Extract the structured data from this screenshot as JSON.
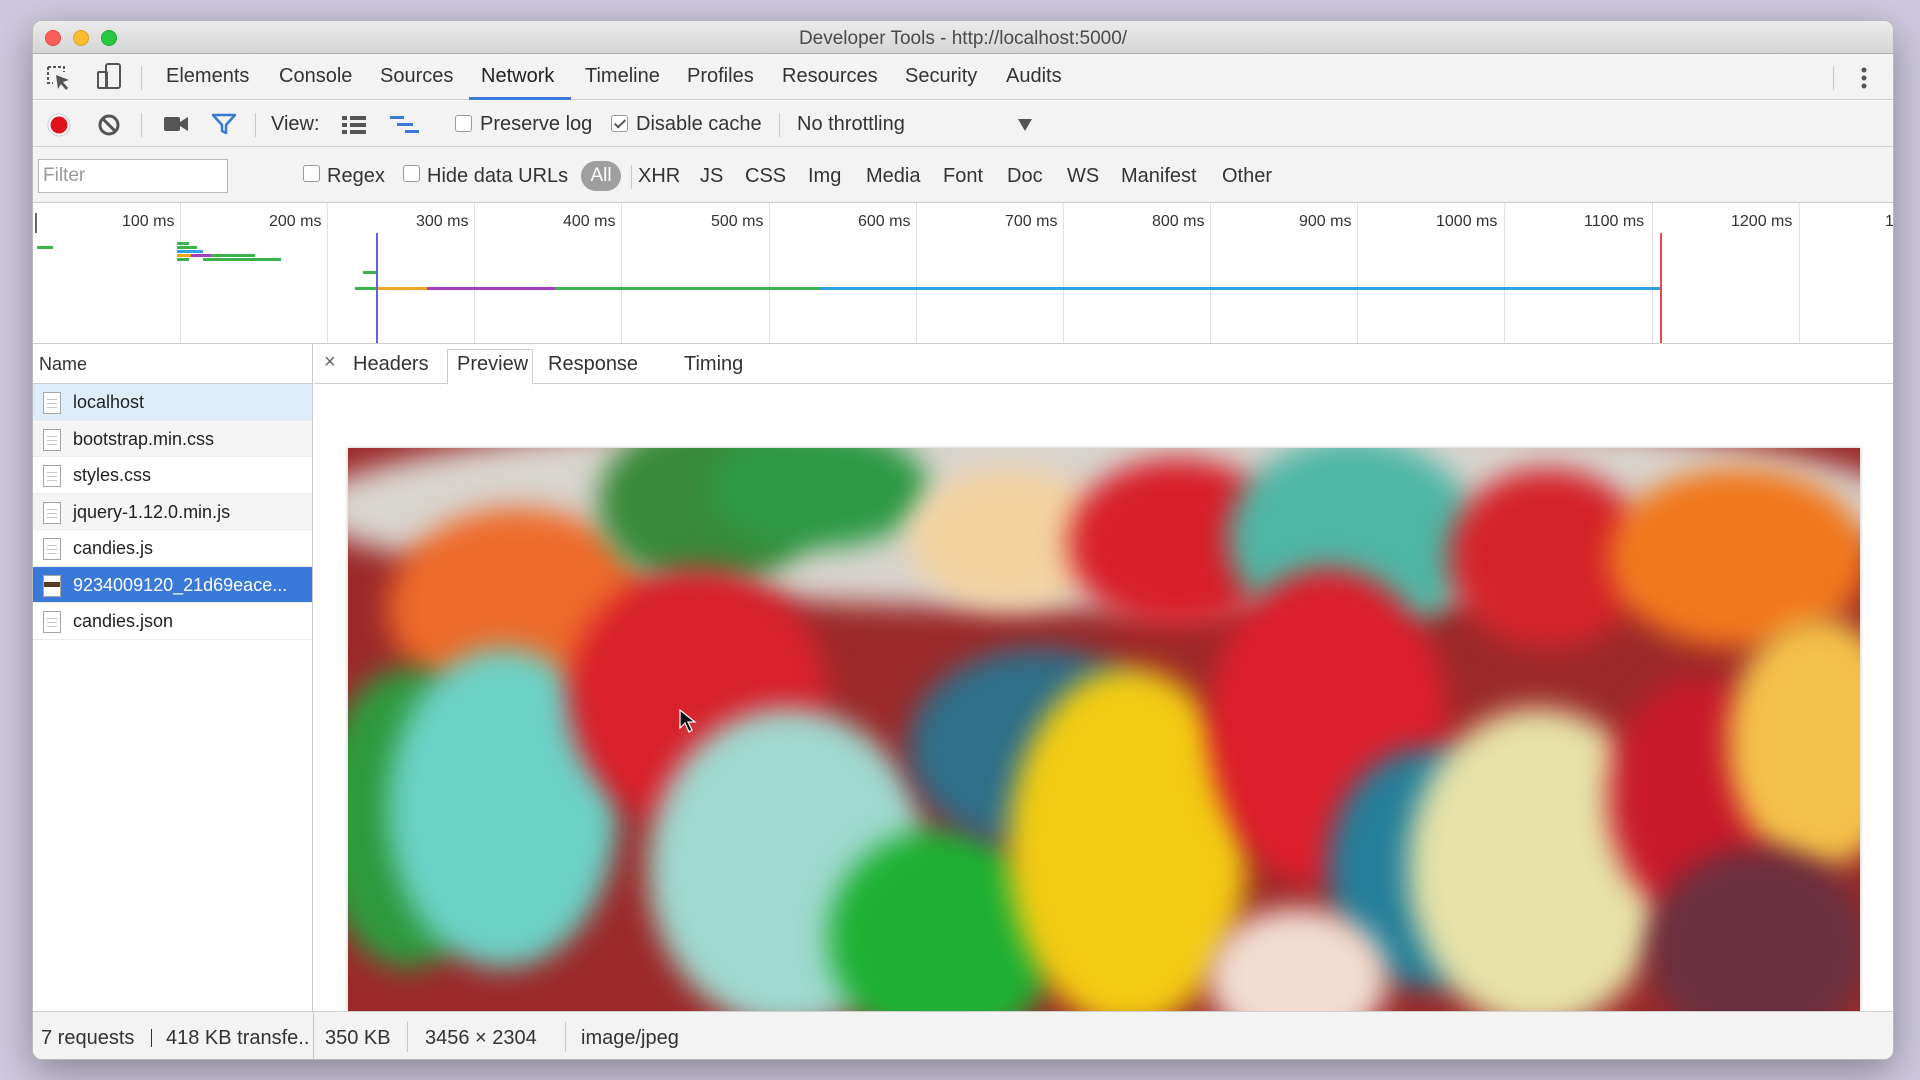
{
  "window": {
    "title": "Developer Tools - http://localhost:5000/"
  },
  "panel_tabs": [
    {
      "label": "Elements"
    },
    {
      "label": "Console"
    },
    {
      "label": "Sources"
    },
    {
      "label": "Network"
    },
    {
      "label": "Timeline"
    },
    {
      "label": "Profiles"
    },
    {
      "label": "Resources"
    },
    {
      "label": "Security"
    },
    {
      "label": "Audits"
    }
  ],
  "active_panel": "Network",
  "toolbar": {
    "view_label": "View:",
    "preserve_log": {
      "label": "Preserve log",
      "checked": false
    },
    "disable_cache": {
      "label": "Disable cache",
      "checked": true
    },
    "throttling": "No throttling",
    "record_color": "#e0121b",
    "filter_icon_color": "#3879d9"
  },
  "filter": {
    "placeholder": "Filter",
    "regex_label": "Regex",
    "hide_data_urls_label": "Hide data URLs",
    "types": [
      "All",
      "XHR",
      "JS",
      "CSS",
      "Img",
      "Media",
      "Font",
      "Doc",
      "WS",
      "Manifest",
      "Other"
    ],
    "active_type": "All"
  },
  "timeline": {
    "ticks": [
      "100 ms",
      "200 ms",
      "300 ms",
      "400 ms",
      "500 ms",
      "600 ms",
      "700 ms",
      "800 ms",
      "900 ms",
      "1000 ms",
      "1100 ms",
      "1200 ms",
      "1"
    ]
  },
  "requests": {
    "header": "Name",
    "items": [
      {
        "name": "localhost",
        "icon": "document-icon"
      },
      {
        "name": "bootstrap.min.css",
        "icon": "document-icon"
      },
      {
        "name": "styles.css",
        "icon": "document-icon"
      },
      {
        "name": "jquery-1.12.0.min.js",
        "icon": "document-icon"
      },
      {
        "name": "candies.js",
        "icon": "document-icon"
      },
      {
        "name": "9234009120_21d69eace...",
        "icon": "image-icon",
        "selected": true
      },
      {
        "name": "candies.json",
        "icon": "blank-file-icon"
      }
    ]
  },
  "detail": {
    "close": "×",
    "tabs": [
      {
        "label": "Headers"
      },
      {
        "label": "Preview"
      },
      {
        "label": "Response"
      },
      {
        "label": "Timing"
      }
    ],
    "active_tab": "Preview"
  },
  "status": {
    "requests": "7 requests",
    "transferred": "418 KB transfe...",
    "size": "350 KB",
    "dimensions": "3456 × 2304",
    "mime": "image/jpeg"
  }
}
